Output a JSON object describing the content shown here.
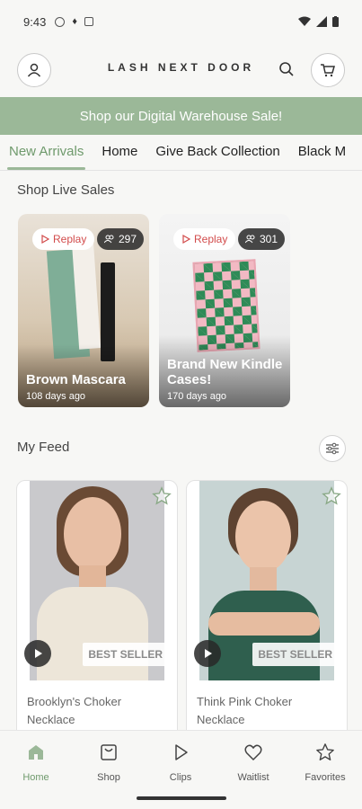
{
  "status": {
    "time": "9:43"
  },
  "header": {
    "brand": "LASH NEXT DOOR"
  },
  "banner": {
    "text": "Shop our Digital Warehouse Sale!"
  },
  "tabs": [
    {
      "label": "New Arrivals",
      "active": true
    },
    {
      "label": "Home"
    },
    {
      "label": "Give Back Collection"
    },
    {
      "label": "Black M"
    }
  ],
  "live_section": {
    "title": "Shop Live Sales",
    "cards": [
      {
        "replay_label": "Replay",
        "viewers": "297",
        "title": "Brown Mascara",
        "age": "108 days ago"
      },
      {
        "replay_label": "Replay",
        "viewers": "301",
        "title": "Brand New Kindle Cases!",
        "age": "170 days ago"
      }
    ]
  },
  "feed_section": {
    "title": "My Feed",
    "cards": [
      {
        "badge": "BEST SELLER",
        "name": "Brooklyn's Choker Necklace"
      },
      {
        "badge": "BEST SELLER",
        "name": "Think Pink Choker Necklace"
      }
    ]
  },
  "bottom_nav": [
    {
      "label": "Home",
      "icon": "home-icon",
      "active": true
    },
    {
      "label": "Shop",
      "icon": "shop-icon"
    },
    {
      "label": "Clips",
      "icon": "play-icon"
    },
    {
      "label": "Waitlist",
      "icon": "heart-icon"
    },
    {
      "label": "Favorites",
      "icon": "star-icon"
    }
  ],
  "colors": {
    "accent": "#9bb898",
    "accent_text": "#6f9a6c",
    "replay_red": "#d24b4b"
  }
}
